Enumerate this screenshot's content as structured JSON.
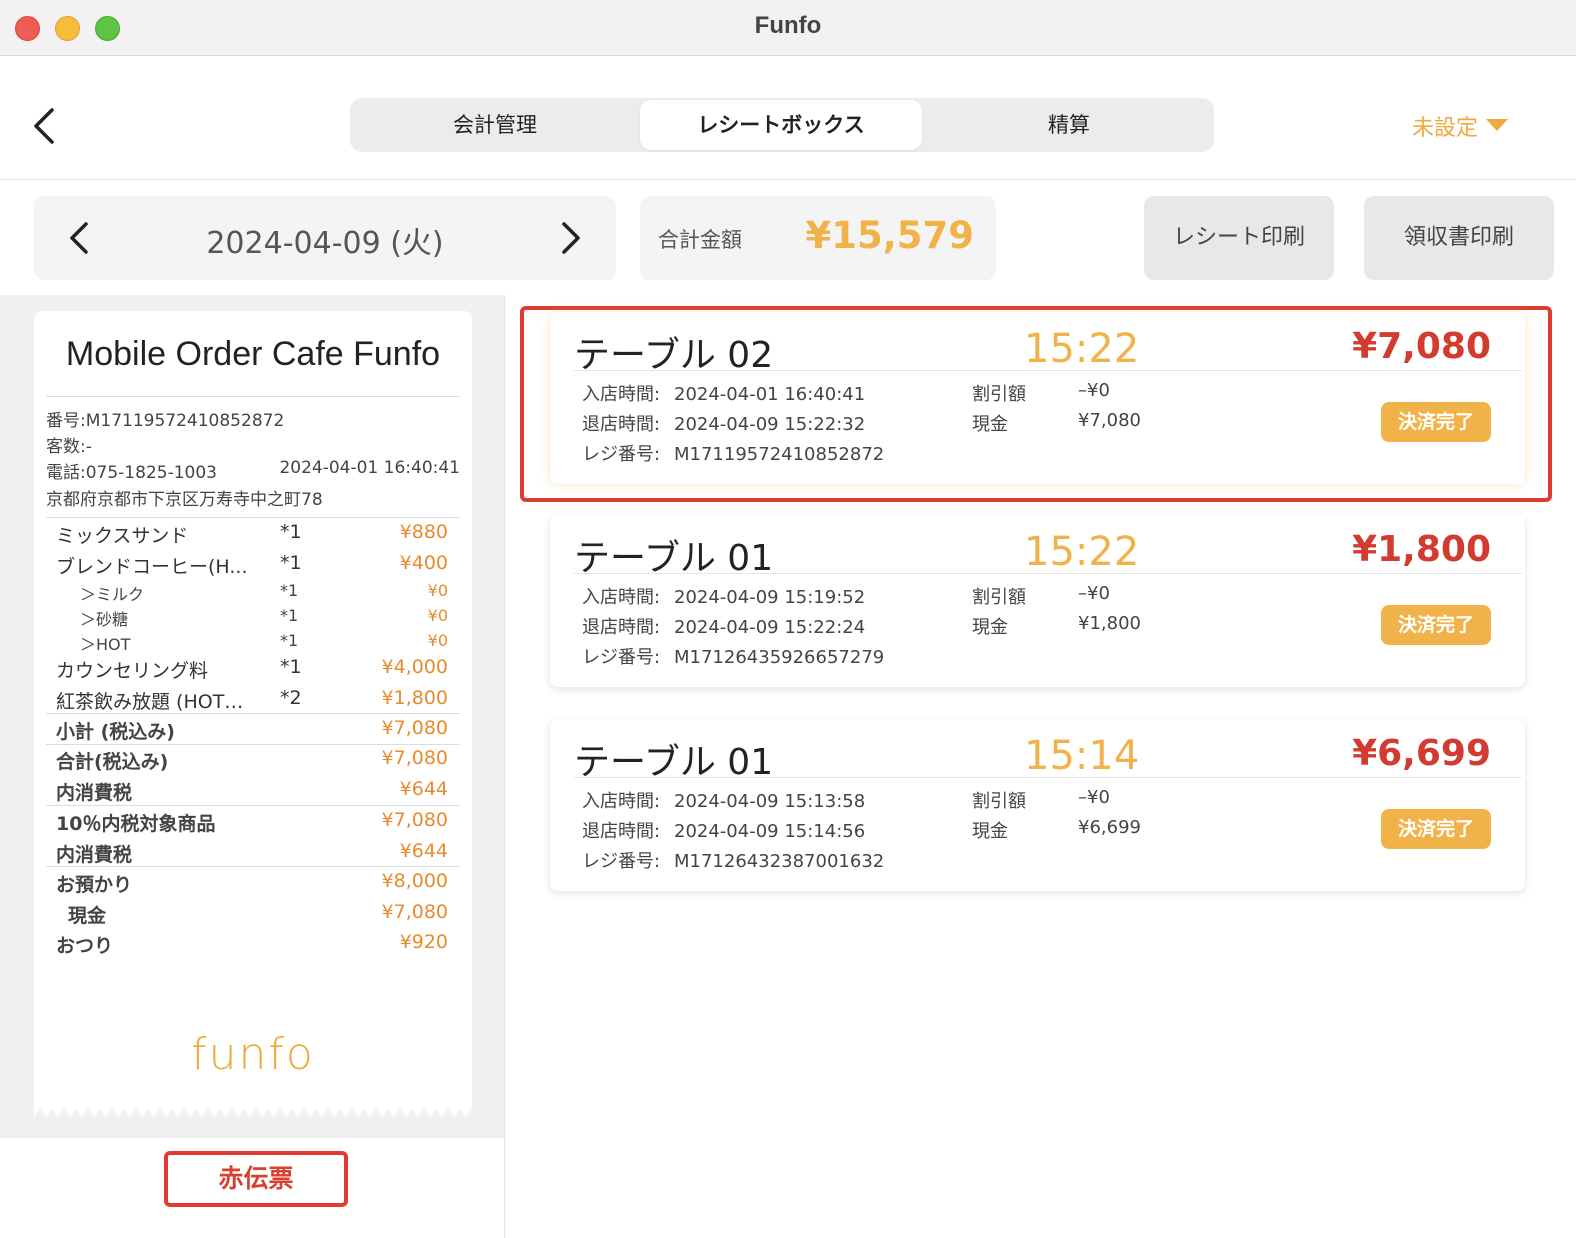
{
  "window": {
    "title": "Funfo"
  },
  "nav": {
    "tabs": [
      {
        "label": "会計管理"
      },
      {
        "label": "レシートボックス"
      },
      {
        "label": "精算"
      }
    ],
    "store_select": "未設定"
  },
  "date_bar": {
    "date": "2024-04-09 (火)",
    "total_label": "合計金額",
    "total_value": "¥15,579",
    "receipt_print": "レシート印刷",
    "invoice_print": "領収書印刷"
  },
  "receipt": {
    "shop_name": "Mobile Order Cafe Funfo",
    "number": "番号:M17119572410852872",
    "guests": "客数:-",
    "phone": "電話:075-1825-1003",
    "datetime": "2024-04-01 16:40:41",
    "address": "京都府京都市下京区万寿寺中之町78",
    "items": [
      {
        "name": "ミックスサンド",
        "qty": "*1",
        "price": "¥880"
      },
      {
        "name": "ブレンドコーヒー(H...",
        "qty": "*1",
        "price": "¥400"
      },
      {
        "name": "＞ミルク",
        "qty": "*1",
        "price": "¥0"
      },
      {
        "name": "＞砂糖",
        "qty": "*1",
        "price": "¥0"
      },
      {
        "name": "＞HOT",
        "qty": "*1",
        "price": "¥0"
      },
      {
        "name": "カウンセリング料",
        "qty": "*1",
        "price": "¥4,000"
      },
      {
        "name": "紅茶飲み放題 (HOT…",
        "qty": "*2",
        "price": "¥1,800"
      }
    ],
    "summary": [
      {
        "name": "小計 (税込み)",
        "price": "¥7,080"
      },
      {
        "name": "合計(税込み)",
        "price": "¥7,080"
      },
      {
        "name": "内消費税",
        "price": "¥644"
      },
      {
        "name": "10％内税対象商品",
        "price": "¥7,080"
      },
      {
        "name": "内消費税",
        "price": "¥644"
      },
      {
        "name": "お預かり",
        "price": "¥8,000"
      },
      {
        "name": "現金",
        "price": "¥7,080"
      },
      {
        "name": "おつり",
        "price": "¥920"
      }
    ],
    "logo": "funfo",
    "red_slip": "赤伝票"
  },
  "labels": {
    "enter": "入店時間:",
    "exit": "退店時間:",
    "register": "レジ番号:",
    "discount": "割引額",
    "cash": "現金"
  },
  "orders": [
    {
      "table": "テーブル 02",
      "time": "15:22",
      "amount": "¥7,080",
      "enter_time": "2024-04-01 16:40:41",
      "exit_time": "2024-04-09 15:22:32",
      "register_no": "M17119572410852872",
      "discount": "–¥0",
      "cash": "¥7,080",
      "status": "決済完了"
    },
    {
      "table": "テーブル 01",
      "time": "15:22",
      "amount": "¥1,800",
      "enter_time": "2024-04-09 15:19:52",
      "exit_time": "2024-04-09 15:22:24",
      "register_no": "M17126435926657279",
      "discount": "–¥0",
      "cash": "¥1,800",
      "status": "決済完了"
    },
    {
      "table": "テーブル 01",
      "time": "15:14",
      "amount": "¥6,699",
      "enter_time": "2024-04-09 15:13:58",
      "exit_time": "2024-04-09 15:14:56",
      "register_no": "M17126432387001632",
      "discount": "–¥0",
      "cash": "¥6,699",
      "status": "決済完了"
    }
  ],
  "colors": {
    "accent": "#f1b24a",
    "amount_red": "#d23b2f",
    "highlight_border": "#e03a33"
  }
}
